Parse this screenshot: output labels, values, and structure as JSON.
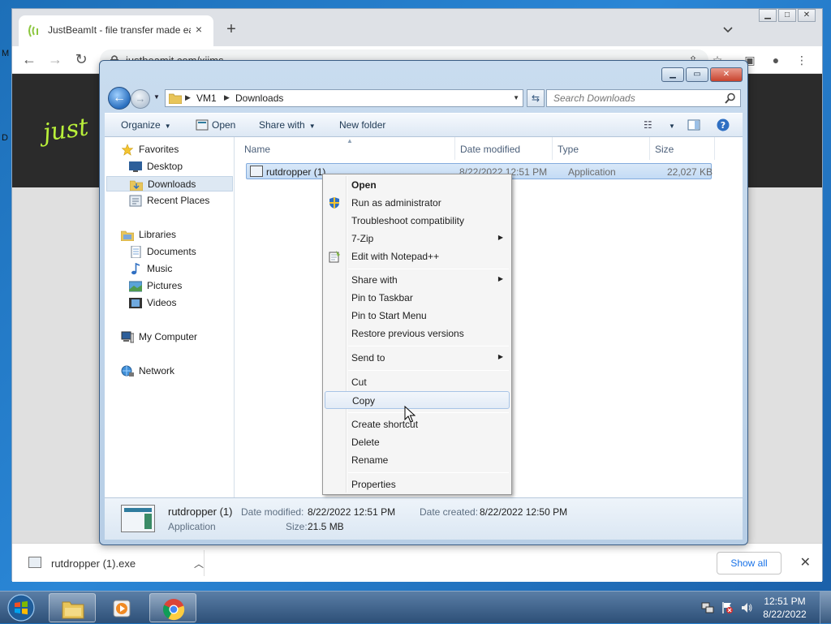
{
  "browser": {
    "tab_title": "JustBeamIt - file transfer made easy",
    "url": "justbeamit.com/xjims",
    "brand_text": "just",
    "downloads": {
      "item_name": "rutdropper (1).exe",
      "show_all_label": "Show all"
    }
  },
  "edge_letters": [
    "M",
    "D"
  ],
  "explorer": {
    "breadcrumb": [
      "VM1",
      "Downloads"
    ],
    "search_placeholder": "Search Downloads",
    "commands": {
      "organize": "Organize",
      "open": "Open",
      "share_with": "Share with",
      "new_folder": "New folder"
    },
    "nav": {
      "favorites": "Favorites",
      "desktop": "Desktop",
      "downloads": "Downloads",
      "recent_places": "Recent Places",
      "libraries": "Libraries",
      "documents": "Documents",
      "music": "Music",
      "pictures": "Pictures",
      "videos": "Videos",
      "my_computer": "My Computer",
      "network": "Network"
    },
    "columns": [
      "Name",
      "Date modified",
      "Type",
      "Size"
    ],
    "file": {
      "name": "rutdropper (1)",
      "date_modified": "8/22/2022 12:51 PM",
      "type": "Application",
      "size": "22,027 KB"
    },
    "details": {
      "file_name": "rutdropper (1)",
      "type": "Application",
      "date_modified_label": "Date modified:",
      "date_modified": "8/22/2022 12:51 PM",
      "date_created_label": "Date created:",
      "date_created": "8/22/2022 12:50 PM",
      "size_label": "Size:",
      "size": "21.5 MB"
    }
  },
  "context_menu": {
    "open": "Open",
    "run_as_admin": "Run as administrator",
    "troubleshoot": "Troubleshoot compatibility",
    "seven_zip": "7-Zip",
    "edit_notepad": "Edit with Notepad++",
    "share_with": "Share with",
    "pin_taskbar": "Pin to Taskbar",
    "pin_start": "Pin to Start Menu",
    "restore_versions": "Restore previous versions",
    "send_to": "Send to",
    "cut": "Cut",
    "copy": "Copy",
    "create_shortcut": "Create shortcut",
    "delete": "Delete",
    "rename": "Rename",
    "properties": "Properties"
  },
  "taskbar": {
    "time": "12:51 PM",
    "date": "8/22/2022"
  },
  "colors": {
    "desktop_blue": "#1d6fb8",
    "selection_blue": "#c3dbf5",
    "link_blue": "#1a73e8",
    "brand_green": "#b9f03a"
  }
}
